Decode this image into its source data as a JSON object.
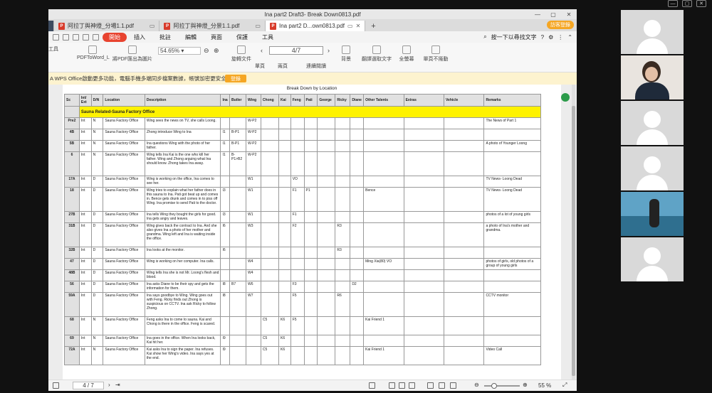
{
  "window": {
    "title": "Ina part2 Draft3- Break Down0813.pdf",
    "controls": [
      "—",
      "▢",
      "✕"
    ]
  },
  "tabs": [
    {
      "label": "阿拉丁與神燈_分場1.1.pdf",
      "active": false
    },
    {
      "label": "阿拉丁與神燈_分景1.1.pdf",
      "active": false
    },
    {
      "label": "Ina part2 D...own0813.pdf",
      "active": true
    }
  ],
  "login_button": "訪客登錄",
  "menu": {
    "items": [
      "開始",
      "插入",
      "批註",
      "編輯",
      "頁面",
      "保護",
      "工具"
    ],
    "active": "開始",
    "search": "按一下以尋找文字"
  },
  "toolbar": {
    "tool_label": "工具",
    "pdf_to_word": "PDFToWord_L",
    "pdf_to_image": "將PDF匯出為圖片",
    "zoom": "54.65%",
    "rotate": "旋轉文件",
    "page_display": "4/7",
    "single_page": "單頁",
    "double_page": "兩頁",
    "continuous": "連續閱讀",
    "background": "背景",
    "translate": "翻譯選取文字",
    "fullscreen": "全螢幕",
    "no_scroll": "單頁不捲動"
  },
  "notice": {
    "text": "A WPS Office啟動更多功能，電腦手機多端同步檔案數據，帳號加密更安全。",
    "button": "登錄"
  },
  "document": {
    "title": "Break Down by Location",
    "columns": [
      "Sc",
      "Int/ Ext",
      "D/N",
      "Location",
      "Description",
      "Ina",
      "Butler",
      "Wing",
      "Chong",
      "Kai",
      "Feng",
      "Pati",
      "George",
      "Ricky",
      "Diane",
      "Other Talents",
      "Extras",
      "Vehicle",
      "Remarks"
    ],
    "section": "Sauna Related-Sauna Factory Office",
    "rows": [
      {
        "cells": [
          "Pre2",
          "Int",
          "N",
          "Sauna Factory Office",
          "Wing sees the news on TV, she calls Loong.",
          "",
          "",
          "W-P2",
          "",
          "",
          "",
          "",
          "",
          "",
          "",
          "",
          "",
          "",
          "The News of Part 1"
        ],
        "h": "std"
      },
      {
        "cells": [
          "4B",
          "Int",
          "N",
          "Sauna Factory Office",
          "Zhong introduce Wing to Ina",
          "I1",
          "B-P1",
          "W-P2",
          "",
          "",
          "",
          "",
          "",
          "",
          "",
          "",
          "",
          "",
          ""
        ],
        "h": "std"
      },
      {
        "cells": [
          "5B",
          "Int",
          "N",
          "Sauna Factory Office",
          "Ina questions Wing with the photo of her father.",
          "I1",
          "B-P1",
          "W-P2",
          "",
          "",
          "",
          "",
          "",
          "",
          "",
          "",
          "",
          "",
          "A photo of Younger Loong"
        ],
        "h": "std"
      },
      {
        "cells": [
          "6",
          "Int",
          "N",
          "Sauna Factory Office",
          "Wing tells Ina Kai is the one who kill her father. Wing and Zhong arguing what Ina should know. Zhong takes Ina away.",
          "I1",
          "B-P1>B2",
          "W-P2",
          "",
          "",
          "",
          "",
          "",
          "",
          "",
          "",
          "",
          "",
          ""
        ],
        "h": "tall"
      },
      {
        "cells": [
          "17A",
          "Int",
          "D",
          "Sauna Factory Office",
          "Wing is working on the office, Ina comes to see her.",
          "",
          "",
          "W1",
          "",
          "",
          "VO",
          "",
          "",
          "",
          "",
          "",
          "",
          "",
          "TV News- Loong Dead"
        ],
        "h": "std"
      },
      {
        "cells": [
          "18",
          "Int",
          "D",
          "Sauna Factory Office",
          "Wing tries to explain what her father does in this sauna to Ina. Pati got beat up and comes in. Bence gets drunk and comes in to piss off Wing. Ina promise to send Pati to the doctor.",
          "I3",
          "",
          "W1",
          "",
          "",
          "F1",
          "P1",
          "",
          "",
          "",
          "Bence",
          "",
          "",
          "TV News- Loong Dead"
        ],
        "h": "tall"
      },
      {
        "cells": [
          "27B",
          "Int",
          "D",
          "Sauna Factory Office",
          "Ina tells Wing they bought the girls for good. Ina gets angry and leaves.",
          "I3",
          "",
          "W1",
          "",
          "",
          "F1",
          "",
          "",
          "",
          "",
          "",
          "",
          "",
          "photos of a lot of young girls"
        ],
        "h": "std"
      },
      {
        "cells": [
          "31B",
          "Int",
          "D",
          "Sauna Factory Office",
          "Wing gives back the contract to Ina. And she also gives Ina a photo of her mother and grandma. Wing left and Ina is waiting inside the office.",
          "I6",
          "",
          "W3",
          "",
          "",
          "F2",
          "",
          "",
          "R3",
          "",
          "",
          "",
          "",
          "a photo of Ina's mother and grandma."
        ],
        "h": "tall"
      },
      {
        "cells": [
          "32B",
          "Int",
          "D",
          "Sauna Factory Office",
          "Ina looks at the monitor.",
          "I6",
          "",
          "",
          "",
          "",
          "",
          "",
          "",
          "R3",
          "",
          "",
          "",
          "",
          ""
        ],
        "h": "std"
      },
      {
        "cells": [
          "47",
          "Int",
          "D",
          "Sauna Factory Office",
          "Wing is working on her computer. Ina calls.",
          "",
          "",
          "W4",
          "",
          "",
          "",
          "",
          "",
          "",
          "",
          "Ming Xia(80) VO",
          "",
          "",
          "photos of girls, old photos of a group of young girls"
        ],
        "h": "std"
      },
      {
        "cells": [
          "48B",
          "Int",
          "D",
          "Sauna Factory Office",
          "Wing tells Ina she is not Mr. Loong's flesh and blood.",
          "",
          "",
          "W4",
          "",
          "",
          "",
          "",
          "",
          "",
          "",
          "",
          "",
          "",
          ""
        ],
        "h": "std"
      },
      {
        "cells": [
          "56",
          "Int",
          "D",
          "Sauna Factory Office",
          "Ina asks Diane to be their spy and gets the information for them.",
          "I8",
          "B7",
          "W6",
          "",
          "",
          "F3",
          "",
          "",
          "",
          "D2",
          "",
          "",
          "",
          ""
        ],
        "h": "std"
      },
      {
        "cells": [
          "59A",
          "Int",
          "D",
          "Sauna Factory Office",
          "Ina says goodbye to Wing. Wing goes out with Feng. Ricky finds out Zhong is suspicious on CCTV. Ina ask Ricky to follow Zhong.",
          "I8",
          "",
          "W7",
          "",
          "",
          "F5",
          "",
          "",
          "R6",
          "",
          "",
          "",
          "",
          "CCTV monitor"
        ],
        "h": "tall"
      },
      {
        "cells": [
          "68",
          "Int",
          "N",
          "Sauna Factory Office",
          "Feng asks Ina to come to sauna. Kai and Chong is there in the office. Feng is scared.",
          "",
          "",
          "",
          "C5",
          "K6",
          "F5",
          "",
          "",
          "",
          "",
          "Kai Friend 1",
          "",
          "",
          ""
        ],
        "h": "mid"
      },
      {
        "cells": [
          "69",
          "Int",
          "N",
          "Sauna Factory Office",
          "Ina goes in the office. When Ina looks back, Kai hit her.",
          "I9",
          "",
          "",
          "C5",
          "K6",
          "",
          "",
          "",
          "",
          "",
          "",
          "",
          "",
          ""
        ],
        "h": "std"
      },
      {
        "cells": [
          "72A",
          "Int",
          "N",
          "Sauna Factory Office",
          "Kai asks Ina to sign the paper. Ina refuses. Kai show her Wing's video. Ina says yes at the end.",
          "I9",
          "",
          "",
          "C5",
          "K6",
          "",
          "",
          "",
          "",
          "",
          "Kai Friend 1",
          "",
          "",
          "Video Call"
        ],
        "h": "mid"
      }
    ]
  },
  "statusbar": {
    "page": "4 / 7",
    "zoom": "55 %"
  },
  "colors": {
    "accent": "#e8432f",
    "section_highlight": "#fef200",
    "login": "#f5a623",
    "notice_bg": "#fdf3cf"
  }
}
